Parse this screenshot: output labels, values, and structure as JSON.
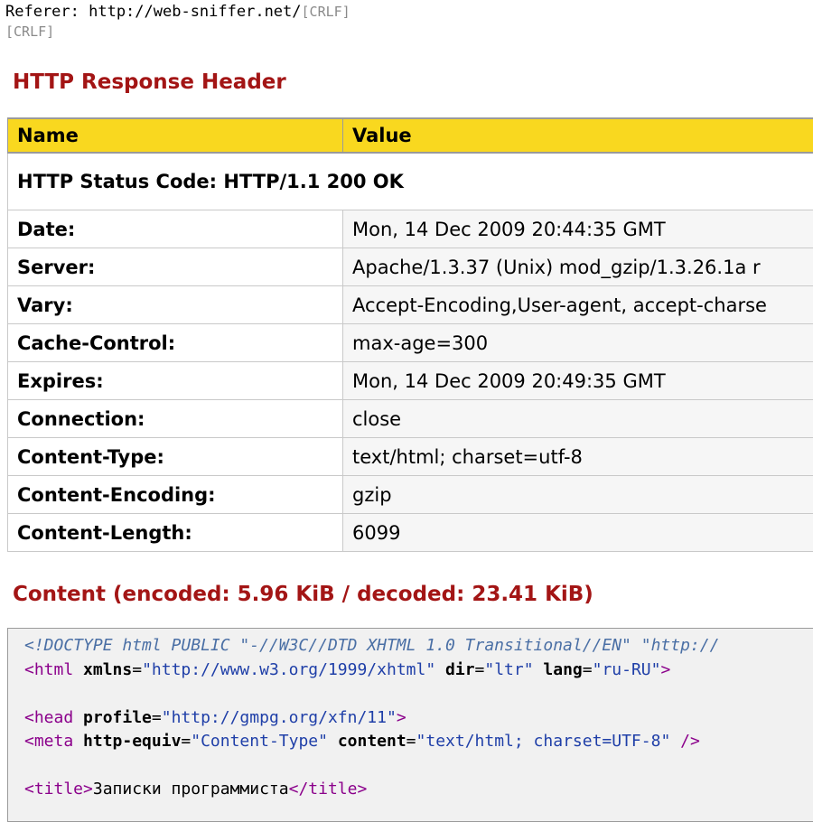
{
  "request_tail": {
    "referer_label": "Referer: http://web-sniffer.net/",
    "crlf": "[CRLF]"
  },
  "response_header": {
    "title": "HTTP Response Header",
    "columns": [
      "Name",
      "Value"
    ],
    "status": "HTTP Status Code: HTTP/1.1 200 OK",
    "rows": [
      {
        "name": "Date:",
        "value": "Mon, 14 Dec 2009 20:44:35 GMT"
      },
      {
        "name": "Server:",
        "value": "Apache/1.3.37 (Unix) mod_gzip/1.3.26.1a r"
      },
      {
        "name": "Vary:",
        "value": "Accept-Encoding,User-agent, accept-charse"
      },
      {
        "name": "Cache-Control:",
        "value": "max-age=300"
      },
      {
        "name": "Expires:",
        "value": "Mon, 14 Dec 2009 20:49:35 GMT"
      },
      {
        "name": "Connection:",
        "value": "close"
      },
      {
        "name": "Content-Type:",
        "value": "text/html; charset=utf-8"
      },
      {
        "name": "Content-Encoding:",
        "value": "gzip"
      },
      {
        "name": "Content-Length:",
        "value": "6099"
      }
    ]
  },
  "content": {
    "title": "Content (encoded: 5.96 KiB / decoded: 23.41 KiB)",
    "source": {
      "doctype": "<!DOCTYPE html PUBLIC \"-//W3C//DTD XHTML 1.0 Transitional//EN\" \"http://",
      "html_open": "<html",
      "html_attr1": "xmlns",
      "html_val1": "\"http://www.w3.org/1999/xhtml\"",
      "html_attr2": "dir",
      "html_val2": "\"ltr\"",
      "html_attr3": "lang",
      "html_val3": "\"ru-RU\"",
      "html_close": ">",
      "head_open": "<head",
      "head_attr": "profile",
      "head_val": "\"http://gmpg.org/xfn/11\"",
      "head_close": ">",
      "meta_open": "<meta",
      "meta_attr1": "http-equiv",
      "meta_val1": "\"Content-Type\"",
      "meta_attr2": "content",
      "meta_val2": "\"text/html; charset=UTF-8\"",
      "meta_close": "/>",
      "title_open": "<title>",
      "title_text": "Записки программиста",
      "title_close": "</title>"
    }
  },
  "colors": {
    "section_title": "#a31515",
    "table_header_bg": "#f9d81f",
    "source_bg": "#f1f1f1"
  }
}
